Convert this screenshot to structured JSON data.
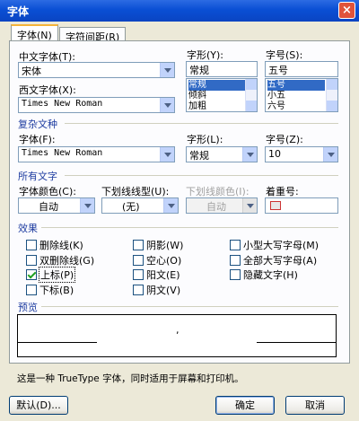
{
  "window": {
    "title": "字体",
    "close_glyph": "×"
  },
  "tabs": [
    {
      "label": "字体(N)"
    },
    {
      "label": "字符间距(R)"
    }
  ],
  "chinese_font": {
    "label": "中文字体(T):",
    "value": "宋体"
  },
  "font_style": {
    "label": "字形(Y):",
    "value": "常规",
    "options": [
      "常规",
      "倾斜",
      "加粗"
    ],
    "selected_index": 0
  },
  "font_size": {
    "label": "字号(S):",
    "value": "五号",
    "options": [
      "五号",
      "小五",
      "六号"
    ],
    "selected_index": 0
  },
  "western_font": {
    "label": "西文字体(X):",
    "value": "Times New Roman"
  },
  "complex_script": {
    "header": "复杂文种",
    "font_label": "字体(F):",
    "font_value": "Times New Roman",
    "style_label": "字形(L):",
    "style_value": "常规",
    "size_label": "字号(Z):",
    "size_value": "10"
  },
  "all_text": {
    "header": "所有文字",
    "color_label": "字体颜色(C):",
    "color_value": "自动",
    "underline_label": "下划线线型(U):",
    "underline_value": "(无)",
    "underline_color_label": "下划线颜色(I):",
    "underline_color_value": "自动",
    "emphasis_label": "着重号:"
  },
  "effects": {
    "header": "效果",
    "items": [
      {
        "label": "删除线(K)",
        "checked": false
      },
      {
        "label": "双删除线(G)",
        "checked": false
      },
      {
        "label": "上标(P)",
        "checked": true
      },
      {
        "label": "下标(B)",
        "checked": false
      },
      {
        "label": "阴影(W)",
        "checked": false
      },
      {
        "label": "空心(O)",
        "checked": false
      },
      {
        "label": "阳文(E)",
        "checked": false
      },
      {
        "label": "阴文(V)",
        "checked": false
      },
      {
        "label": "小型大写字母(M)",
        "checked": false
      },
      {
        "label": "全部大写字母(A)",
        "checked": false
      },
      {
        "label": "隐藏文字(H)",
        "checked": false
      }
    ]
  },
  "preview": {
    "header": "预览",
    "sample": ","
  },
  "status_text": "这是一种 TrueType 字体，同时适用于屏幕和打印机。",
  "buttons": {
    "default": "默认(D)...",
    "ok": "确定",
    "cancel": "取消"
  }
}
